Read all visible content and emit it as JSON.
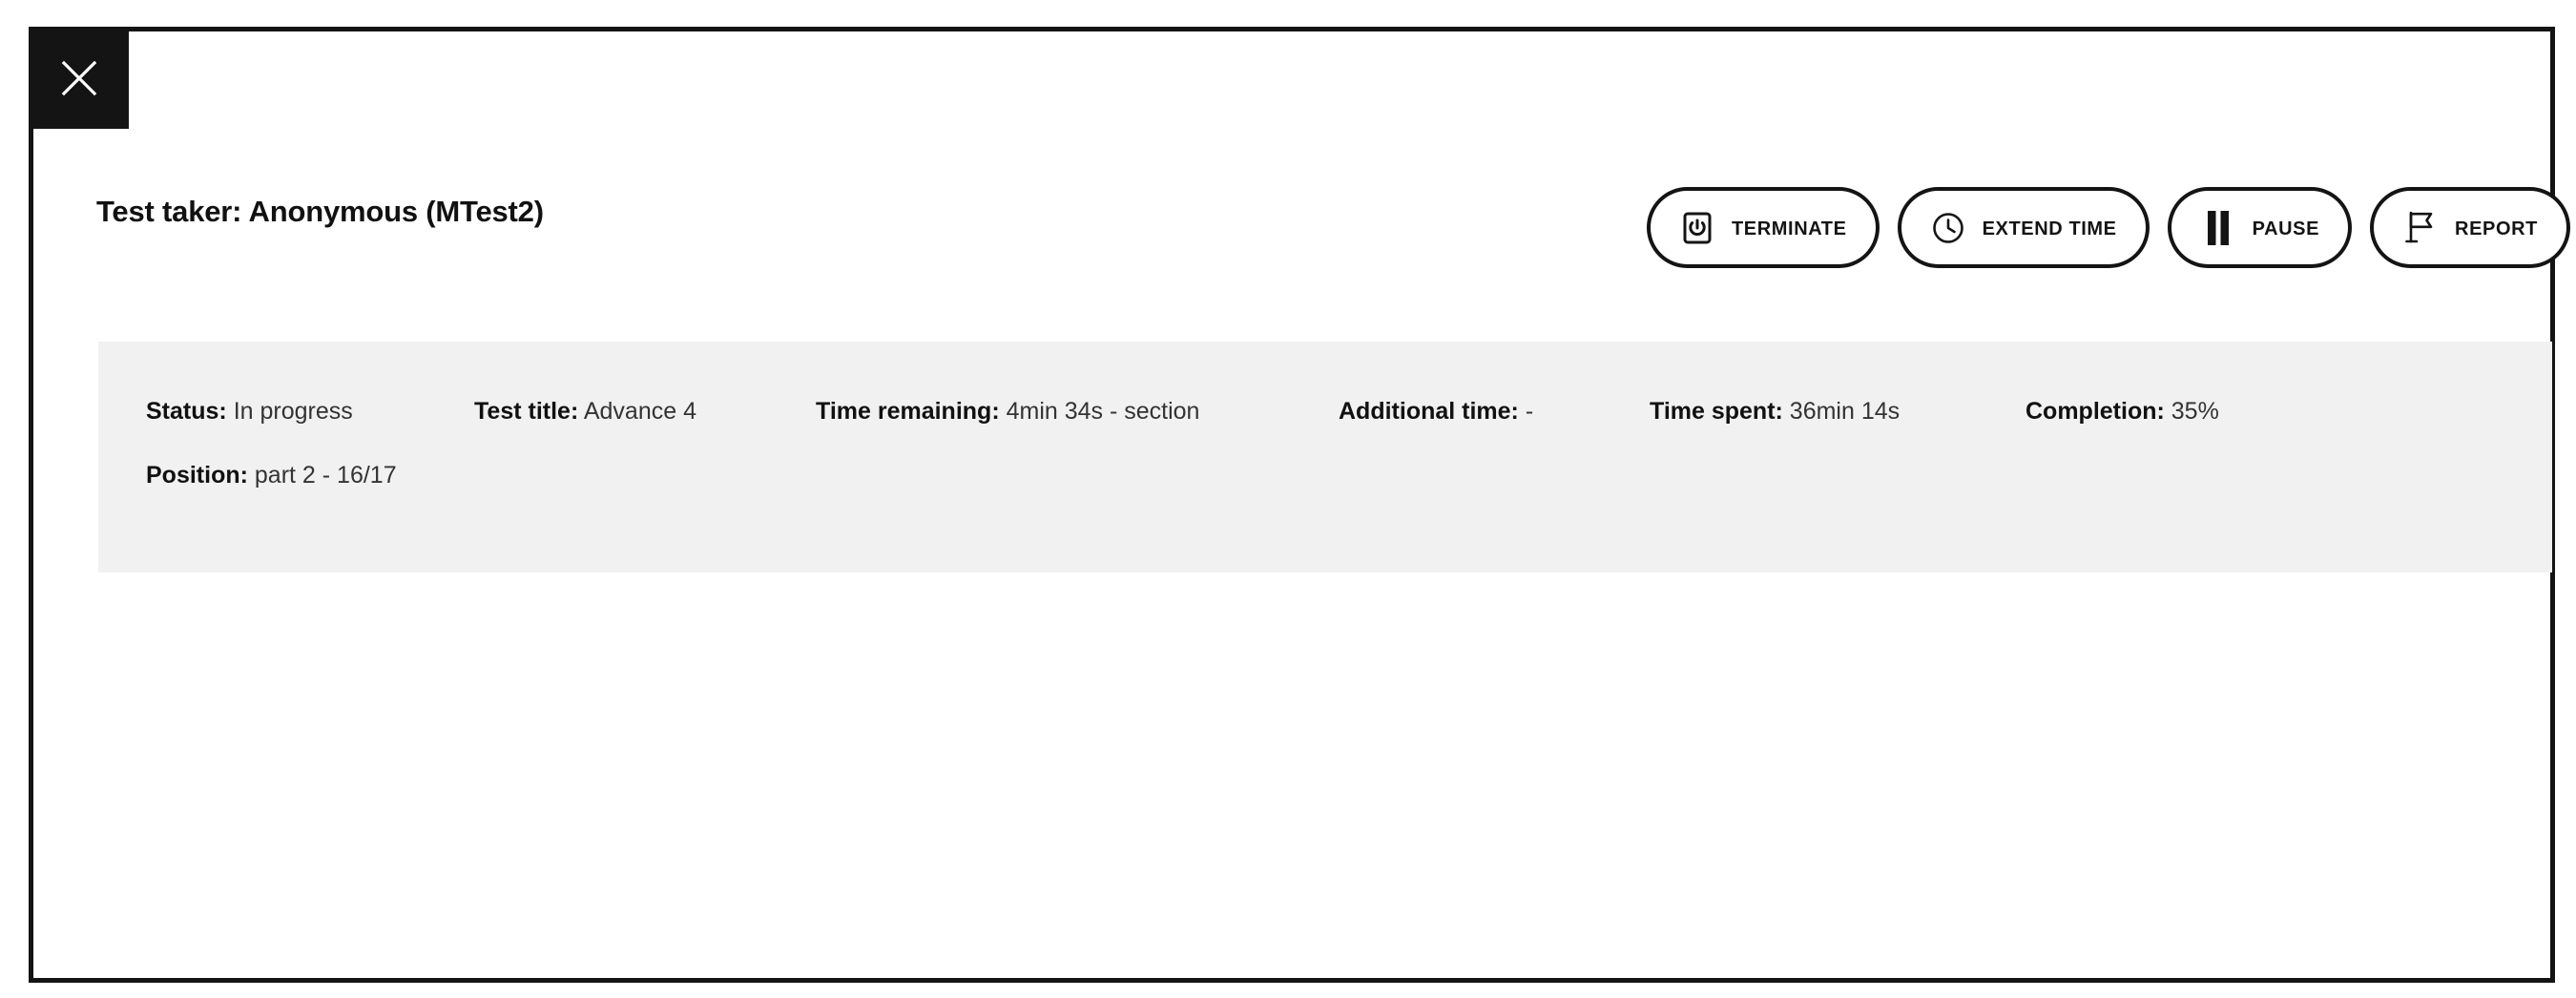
{
  "window": {
    "close_icon": "close-icon"
  },
  "header": {
    "title": "Test taker: Anonymous (MTest2)",
    "actions": [
      {
        "id": "terminate",
        "label": "TERMINATE",
        "icon": "power-icon"
      },
      {
        "id": "extend_time",
        "label": "EXTEND TIME",
        "icon": "clock-icon"
      },
      {
        "id": "pause",
        "label": "PAUSE",
        "icon": "pause-icon"
      },
      {
        "id": "report",
        "label": "REPORT",
        "icon": "flag-icon"
      }
    ]
  },
  "summary": {
    "status": {
      "label": "Status:",
      "value": "In progress"
    },
    "test_title": {
      "label": "Test title:",
      "value": "Advance 4"
    },
    "time_remaining": {
      "label": "Time remaining:",
      "value": "4min 34s - section"
    },
    "additional_time": {
      "label": "Additional time:",
      "value": "-"
    },
    "time_spent": {
      "label": "Time spent:",
      "value": "36min 14s"
    },
    "completion": {
      "label": "Completion:",
      "value": "35%"
    },
    "position": {
      "label": "Position:",
      "value": "part 2 - 16/17"
    }
  },
  "colors": {
    "frame": "#141414",
    "panel_background": "#f1f1f1",
    "page_background": "#ffffff",
    "text": "#111111"
  }
}
